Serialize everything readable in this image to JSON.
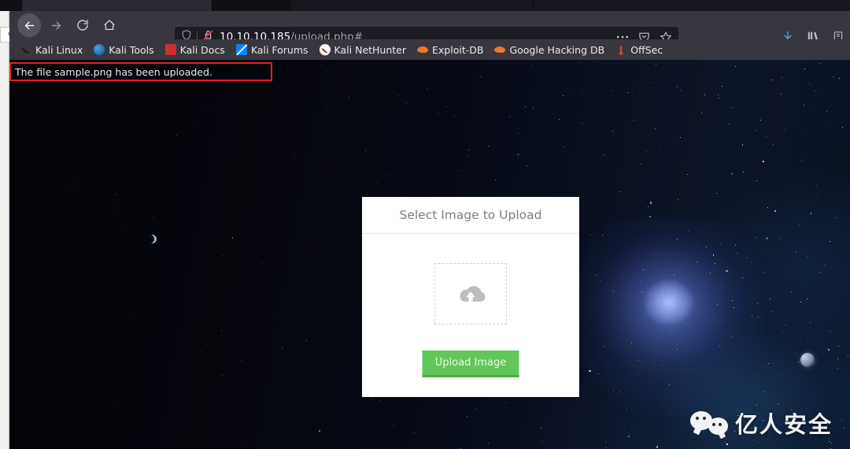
{
  "browser": {
    "tabs_partial": [
      "",
      "",
      ""
    ],
    "nav": {
      "back_icon": "back-arrow-icon",
      "forward_icon": "forward-arrow-icon",
      "reload_icon": "reload-icon",
      "home_icon": "home-icon"
    },
    "urlbar": {
      "shield_icon": "shield-icon",
      "security_icon": "insecure-lock-crossed-icon",
      "host": "10.10.10.185",
      "path": "/upload.php#",
      "page_actions_icon": "ellipsis-icon",
      "pocket_icon": "pocket-icon",
      "bookmark_star_icon": "star-icon"
    },
    "toolbar_right": {
      "downloads_icon": "download-arrow-icon",
      "library_icon": "library-books-icon",
      "account_icon": "account-icon"
    },
    "bookmarks": [
      {
        "label": "Kali Linux",
        "icon": "kali-dragon-icon"
      },
      {
        "label": "Kali Tools",
        "icon": "kali-tools-icon"
      },
      {
        "label": "Kali Docs",
        "icon": "kali-docs-icon"
      },
      {
        "label": "Kali Forums",
        "icon": "kali-forums-icon"
      },
      {
        "label": "Kali NetHunter",
        "icon": "kali-nethunter-icon"
      },
      {
        "label": "Exploit-DB",
        "icon": "exploitdb-icon"
      },
      {
        "label": "Google Hacking DB",
        "icon": "ghdb-icon"
      },
      {
        "label": "OffSec",
        "icon": "offsec-icon"
      }
    ]
  },
  "page": {
    "status_message": "The file sample.png has been uploaded.",
    "status_highlight_color": "#e02020",
    "card": {
      "title": "Select Image to Upload",
      "dropzone_icon": "cloud-upload-icon",
      "upload_button_label": "Upload Image",
      "upload_button_color": "#61c75a"
    },
    "watermark": {
      "text": "亿人安全",
      "icon": "wechat-icon"
    }
  },
  "desktop": {
    "side_tab_label": "vm"
  }
}
